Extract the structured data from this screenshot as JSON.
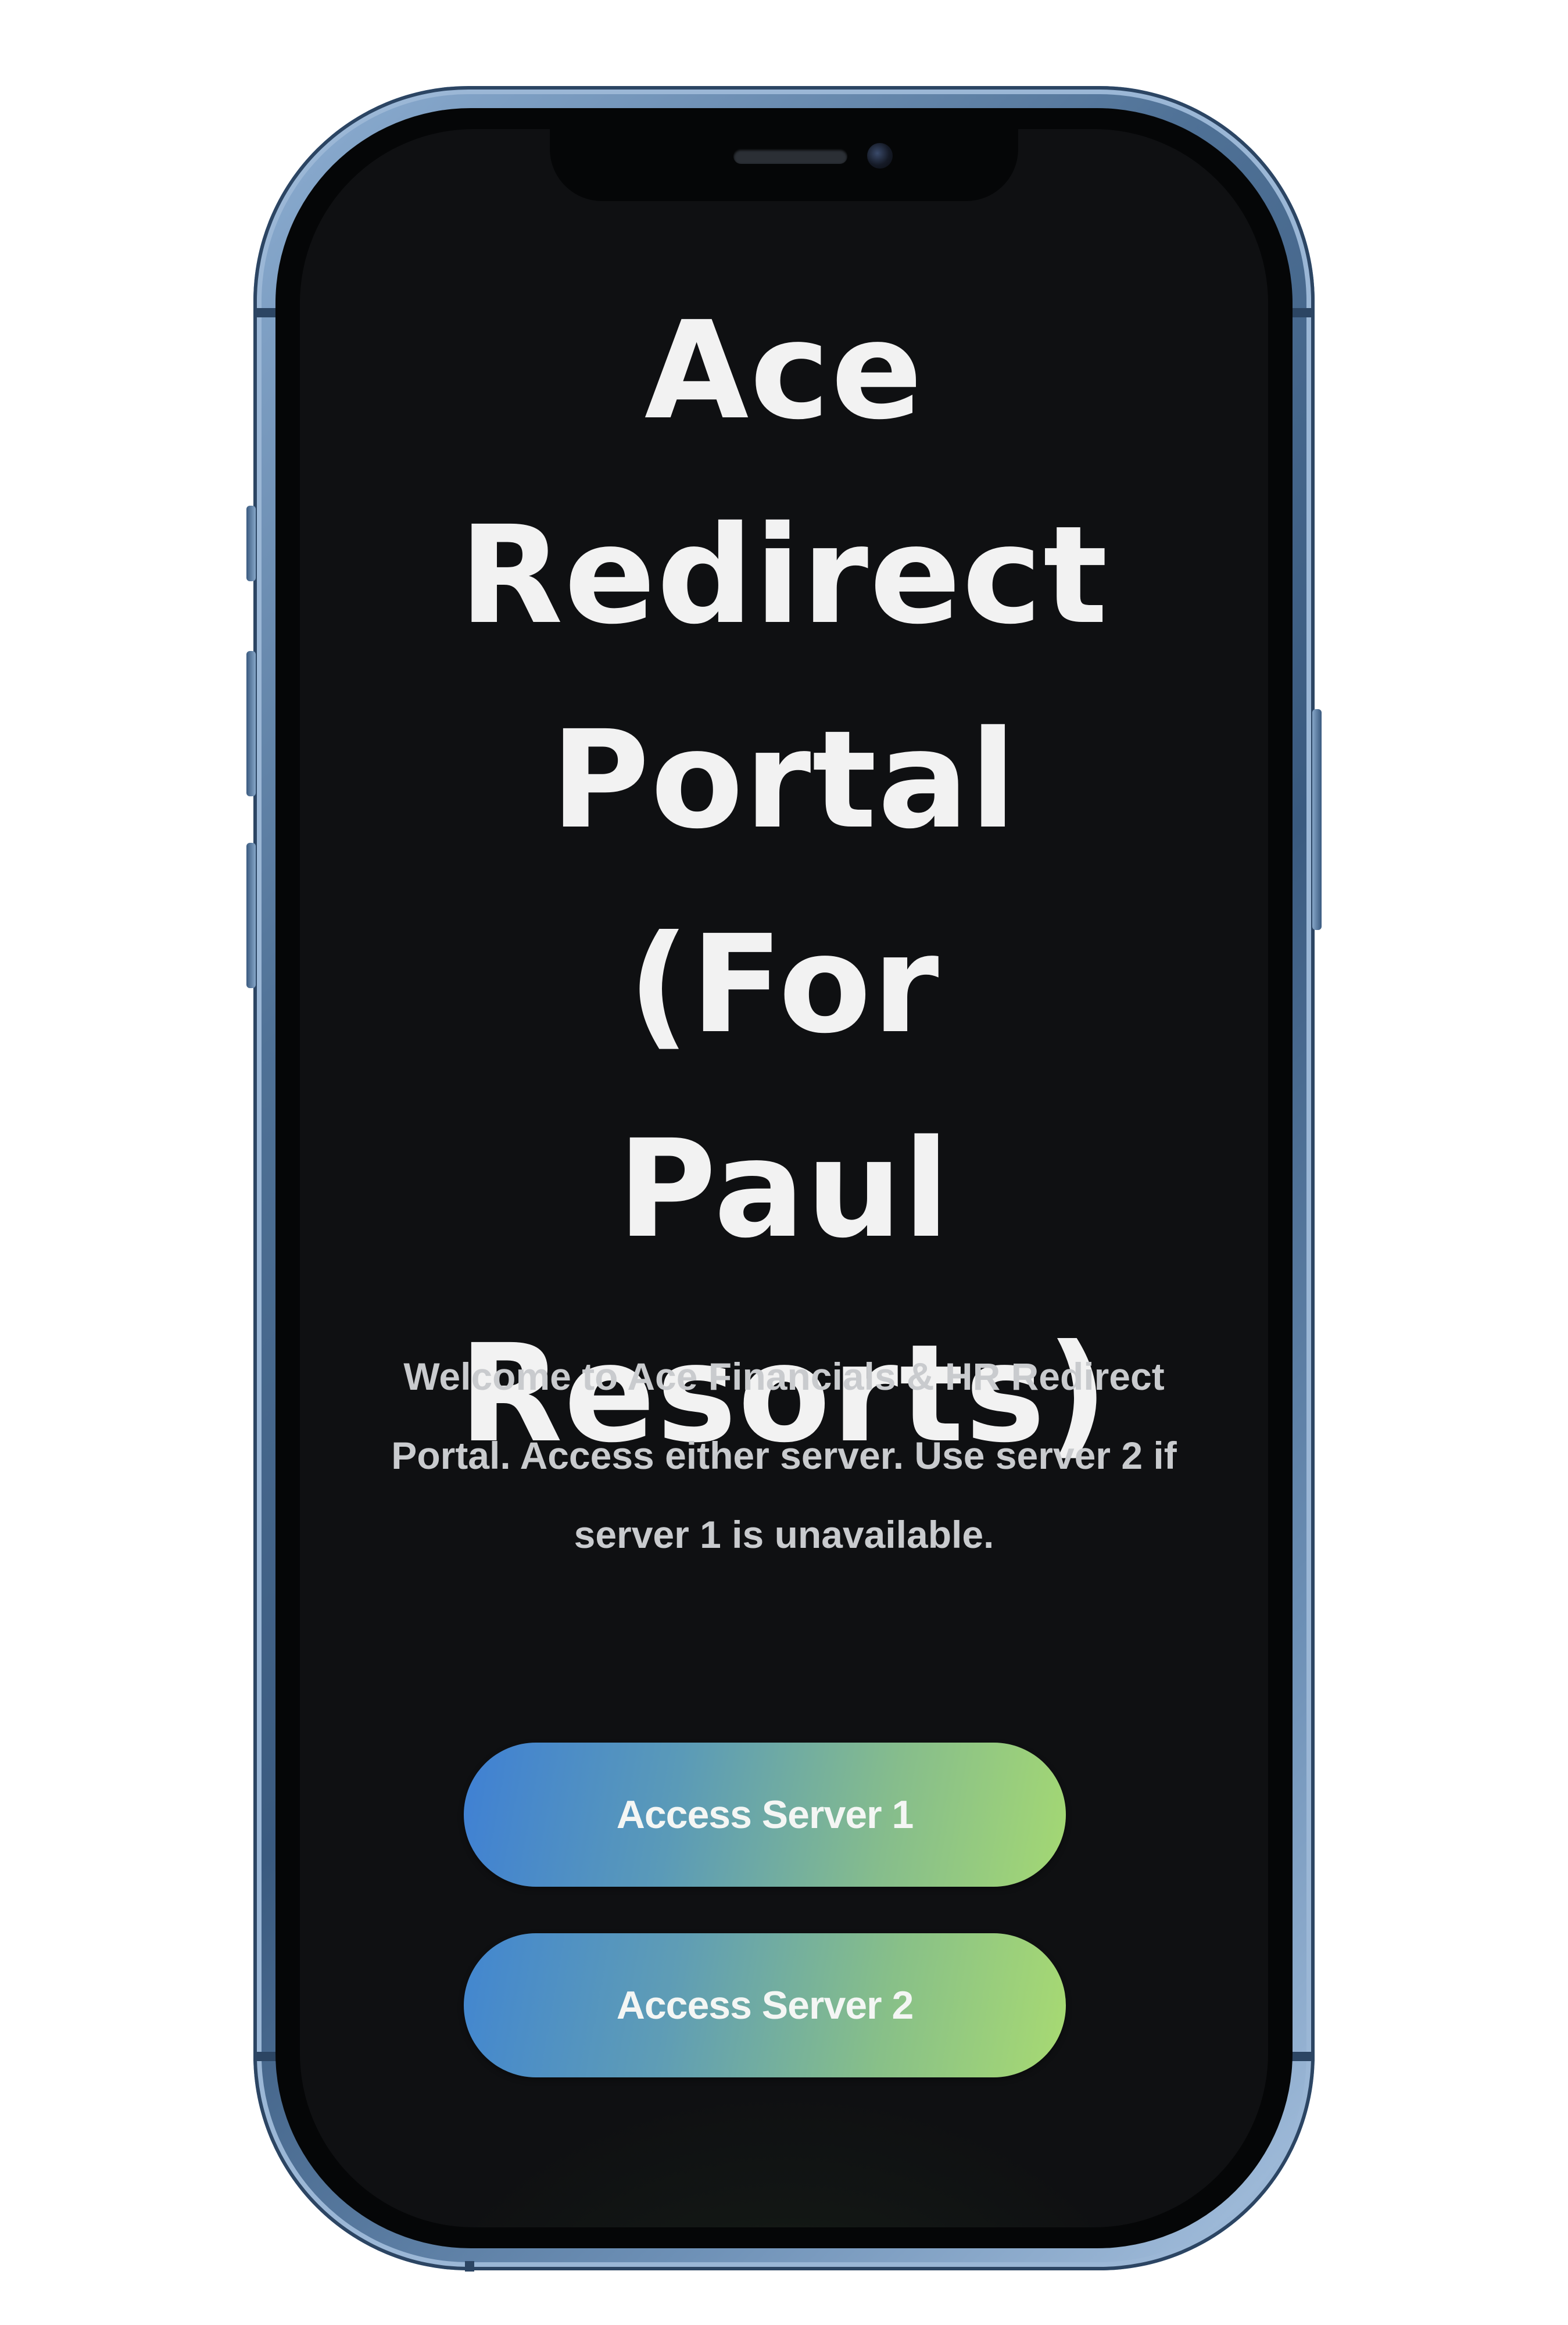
{
  "page": {
    "title": "Ace\nRedirect\nPortal (For\nPaul\nResorts)",
    "description": "Welcome to Ace Financials & HR Redirect Portal. Access either server. Use server 2 if server 1 is unavailable."
  },
  "buttons": {
    "server1_label": "Access Server 1",
    "server2_label": "Access Server 2"
  },
  "colors": {
    "background": "#0f1012",
    "gradient_start": "#3f80d4",
    "gradient_end": "#a4d873",
    "device_frame": "#4f7196"
  }
}
